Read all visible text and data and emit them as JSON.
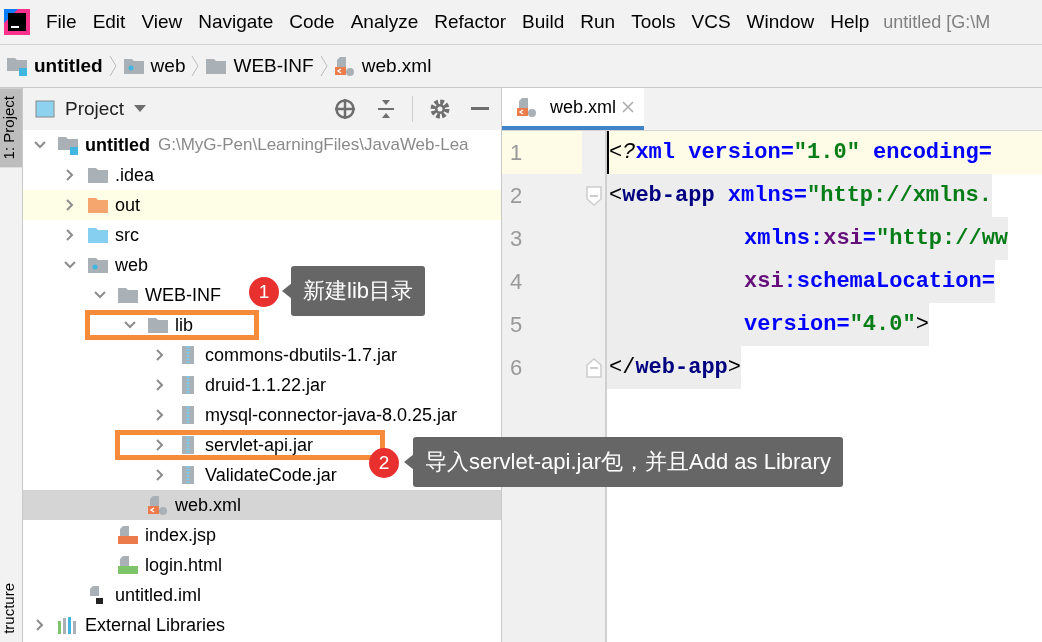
{
  "menu": [
    "File",
    "Edit",
    "View",
    "Navigate",
    "Code",
    "Analyze",
    "Refactor",
    "Build",
    "Run",
    "Tools",
    "VCS",
    "Window",
    "Help"
  ],
  "window_title": "untitled [G:\\M",
  "breadcrumb": [
    {
      "label": "untitled",
      "kind": "module"
    },
    {
      "label": "web",
      "kind": "webfolder"
    },
    {
      "label": "WEB-INF",
      "kind": "folder"
    },
    {
      "label": "web.xml",
      "kind": "xml"
    }
  ],
  "side_tabs": [
    {
      "label": "1: Project",
      "selected": true
    },
    {
      "label": "tructure",
      "selected": false
    }
  ],
  "project_panel": {
    "title": "Project",
    "tree": [
      {
        "label": "untitled",
        "path": "G:\\MyG-Pen\\LearningFiles\\JavaWeb-Lea",
        "kind": "module",
        "expanded": true,
        "selected": false,
        "children": [
          {
            "label": ".idea",
            "kind": "folder",
            "expanded": false,
            "selected": false
          },
          {
            "label": "out",
            "kind": "excluded",
            "expanded": false,
            "selected": false,
            "excluded": true
          },
          {
            "label": "src",
            "kind": "source",
            "expanded": false,
            "selected": false
          },
          {
            "label": "web",
            "kind": "webfolder",
            "expanded": true,
            "selected": false,
            "children": [
              {
                "label": "WEB-INF",
                "kind": "folder",
                "expanded": true,
                "selected": false,
                "children": [
                  {
                    "label": "lib",
                    "kind": "folder",
                    "expanded": true,
                    "selected": false,
                    "boxed": true,
                    "children": [
                      {
                        "label": "commons-dbutils-1.7.jar",
                        "kind": "jar",
                        "expanded": false,
                        "selected": false
                      },
                      {
                        "label": "druid-1.1.22.jar",
                        "kind": "jar",
                        "expanded": false,
                        "selected": false
                      },
                      {
                        "label": "mysql-connector-java-8.0.25.jar",
                        "kind": "jar",
                        "expanded": false,
                        "selected": false
                      },
                      {
                        "label": "servlet-api.jar",
                        "kind": "jar",
                        "expanded": false,
                        "selected": false,
                        "boxed": true
                      },
                      {
                        "label": "ValidateCode.jar",
                        "kind": "jar",
                        "expanded": false,
                        "selected": false
                      }
                    ]
                  },
                  {
                    "label": "web.xml",
                    "kind": "xml",
                    "selected": true
                  }
                ]
              },
              {
                "label": "index.jsp",
                "kind": "jsp",
                "selected": false
              },
              {
                "label": "login.html",
                "kind": "html",
                "selected": false
              }
            ]
          },
          {
            "label": "untitled.iml",
            "kind": "iml",
            "selected": false
          }
        ]
      },
      {
        "label": "External Libraries",
        "kind": "libraries",
        "expanded": false,
        "selected": false
      }
    ]
  },
  "editor": {
    "tabs": [
      {
        "label": "web.xml",
        "kind": "xml",
        "selected": true
      }
    ],
    "lines": [
      {
        "number": "1",
        "current": true,
        "indented": false,
        "tokens": [
          {
            "kind": "punct",
            "text": "<"
          },
          {
            "kind": "pi",
            "text": "?"
          },
          {
            "kind": "attr",
            "text": "xml version="
          },
          {
            "kind": "value",
            "text": "\"1.0\""
          },
          {
            "kind": "attr",
            "text": " encoding="
          }
        ]
      },
      {
        "number": "2",
        "current": false,
        "indented": false,
        "kind": "fold_start",
        "tokens": [
          {
            "kind": "punct",
            "text": "<"
          },
          {
            "kind": "tag",
            "text": "web-app"
          },
          {
            "kind": "attr",
            "text": " xmlns="
          },
          {
            "kind": "value",
            "text": "\"http://xmlns."
          }
        ]
      },
      {
        "number": "3",
        "current": false,
        "indented": true,
        "tokens": [
          {
            "kind": "attr",
            "text": "xmlns:"
          },
          {
            "kind": "ns",
            "text": "xsi"
          },
          {
            "kind": "attr",
            "text": "="
          },
          {
            "kind": "value",
            "text": "\"http://ww"
          }
        ]
      },
      {
        "number": "4",
        "current": false,
        "indented": true,
        "tokens": [
          {
            "kind": "ns",
            "text": "xsi"
          },
          {
            "kind": "attr",
            "text": ":schemaLocation="
          }
        ]
      },
      {
        "number": "5",
        "current": false,
        "indented": true,
        "tokens": [
          {
            "kind": "attr",
            "text": "version="
          },
          {
            "kind": "value",
            "text": "\"4.0\""
          },
          {
            "kind": "punct",
            "text": ">"
          }
        ]
      },
      {
        "number": "6",
        "current": false,
        "indented": false,
        "kind": "fold_end",
        "tokens": [
          {
            "kind": "punct",
            "text": "</"
          },
          {
            "kind": "tag",
            "text": "web-app"
          },
          {
            "kind": "punct",
            "text": ">"
          }
        ]
      }
    ]
  },
  "callouts": [
    {
      "number": "1",
      "text": "新建lib目录"
    },
    {
      "number": "2",
      "text": "导入servlet-api.jar包，并且Add as Library"
    }
  ]
}
